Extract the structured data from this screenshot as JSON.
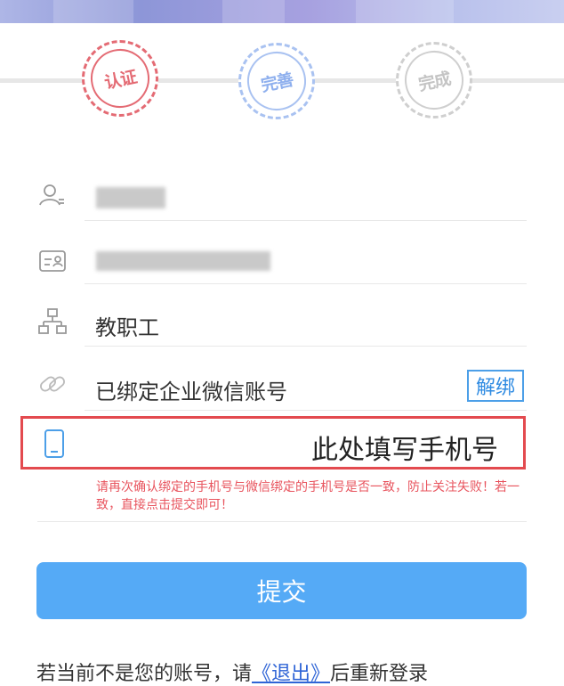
{
  "steps": [
    {
      "label": "认证",
      "state": "done",
      "color": "#e46b74"
    },
    {
      "label": "完善",
      "state": "current",
      "color": "#8fb0ee"
    },
    {
      "label": "完成",
      "state": "pending",
      "color": "#c4c4c4"
    }
  ],
  "form": {
    "identity_value": "教职工",
    "wechat_status": "已绑定企业微信账号",
    "unbind_label": "解绑",
    "phone_placeholder": "此处填写手机号",
    "phone_hint": "请再次确认绑定的手机号与微信绑定的手机号是否一致，防止关注失败！若一致，直接点击提交即可！"
  },
  "submit_label": "提交",
  "footer": {
    "prefix": "若当前不是您的账号，请",
    "logout_link": "《退出》",
    "suffix": "后重新登录"
  },
  "colors": {
    "accent": "#55aaf6",
    "error": "#e34a4f",
    "link": "#2f64d6"
  },
  "icons": [
    "user-icon",
    "id-card-icon",
    "org-icon",
    "link-icon",
    "phone-icon"
  ]
}
